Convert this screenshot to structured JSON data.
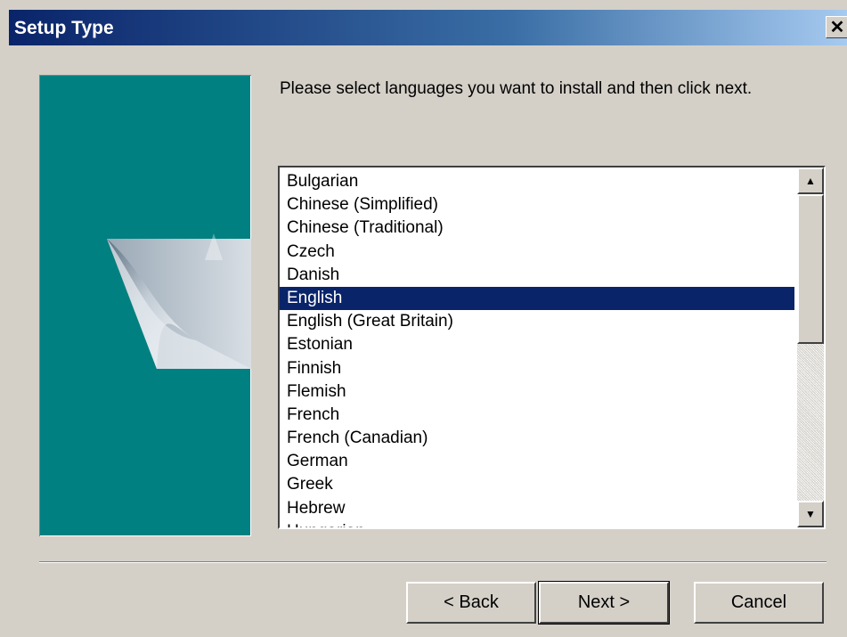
{
  "window": {
    "title": "Setup Type",
    "close_glyph": "✕"
  },
  "instruction": "Please select languages you want to install and then click next.",
  "languages": {
    "items": [
      "Bulgarian",
      "Chinese (Simplified)",
      "Chinese (Traditional)",
      "Czech",
      "Danish",
      "English",
      "English (Great Britain)",
      "Estonian",
      "Finnish",
      "Flemish",
      "French",
      "French (Canadian)",
      "German",
      "Greek",
      "Hebrew",
      "Hungarian"
    ],
    "selected": "English",
    "scroll_up_glyph": "▲",
    "scroll_down_glyph": "▼"
  },
  "buttons": {
    "back": "< Back",
    "next": "Next >",
    "cancel": "Cancel"
  },
  "colors": {
    "title_bar_start": "#0a246a",
    "title_bar_end": "#a6caf0",
    "panel": "#008080",
    "face": "#d4d0c8",
    "selection": "#0a246a"
  },
  "icons": {
    "side_graphic": "page-curl-graphic",
    "close": "close-icon"
  }
}
